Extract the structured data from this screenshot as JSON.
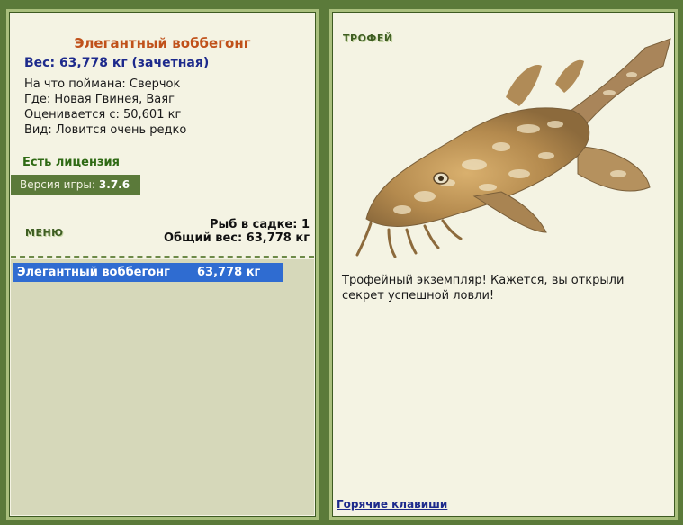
{
  "left_panel": {
    "fish_name": "Элегантный воббегонг",
    "weight_line": "Вес: 63,778 кг (зачетная)",
    "info": [
      "На что поймана: Сверчок",
      "Где: Новая Гвинея, Ваяг",
      "Оценивается с: 50,601 кг",
      "Вид: Ловится очень редко"
    ],
    "license": "Есть лицензия",
    "version_label": "Версия игры:",
    "version_value": "3.7.6",
    "menu_label": "МЕНЮ",
    "keep_count": "Рыб в садке: 1",
    "keep_total": "Общий вес: 63,778 кг",
    "keep_list": [
      {
        "name": "Элегантный воббегонг",
        "weight": "63,778 кг"
      }
    ]
  },
  "right_panel": {
    "trophy_label": "ТРОФЕЙ",
    "fish_image_icon": "wobbegong-shark-image",
    "message": "Трофейный экземпляр! Кажется, вы открыли секрет успешной ловли!",
    "hotkeys_link": "Горячие клавиши"
  },
  "colors": {
    "background": "#5b7a3a",
    "panel": "#f4f3e3",
    "fish_title": "#c0511a",
    "weight": "#1d2a8c",
    "license": "#2f6a14",
    "selection": "#2f6cd1",
    "keep_list_bg": "#d6d8ba"
  }
}
